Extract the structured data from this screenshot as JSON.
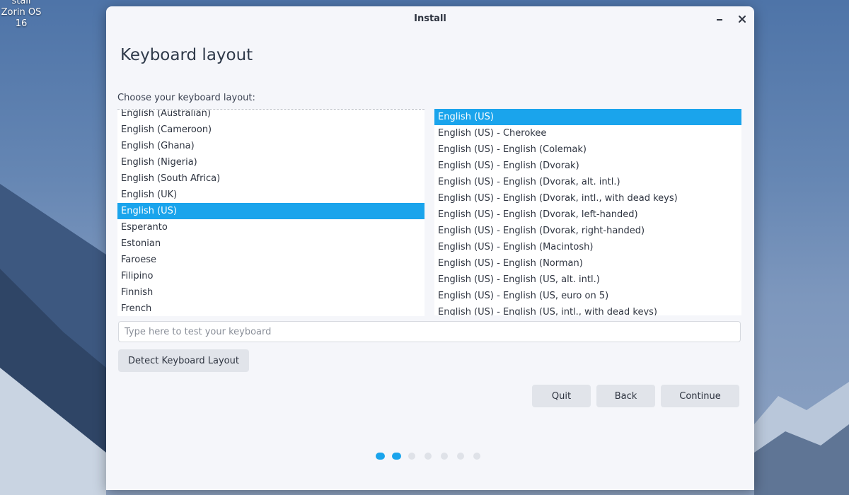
{
  "desktop": {
    "icon_label_line1": "stall Zorin OS",
    "icon_label_line2": "16"
  },
  "window": {
    "title": "Install",
    "minimize_icon": "minimize-icon",
    "close_icon": "close-icon"
  },
  "page": {
    "heading": "Keyboard layout",
    "prompt": "Choose your keyboard layout:"
  },
  "layouts": {
    "items": [
      {
        "label": "English (Australian)",
        "selected": false
      },
      {
        "label": "English (Cameroon)",
        "selected": false
      },
      {
        "label": "English (Ghana)",
        "selected": false
      },
      {
        "label": "English (Nigeria)",
        "selected": false
      },
      {
        "label": "English (South Africa)",
        "selected": false
      },
      {
        "label": "English (UK)",
        "selected": false
      },
      {
        "label": "English (US)",
        "selected": true
      },
      {
        "label": "Esperanto",
        "selected": false
      },
      {
        "label": "Estonian",
        "selected": false
      },
      {
        "label": "Faroese",
        "selected": false
      },
      {
        "label": "Filipino",
        "selected": false
      },
      {
        "label": "Finnish",
        "selected": false
      },
      {
        "label": "French",
        "selected": false
      }
    ]
  },
  "variants": {
    "items": [
      {
        "label": "English (US)",
        "selected": true
      },
      {
        "label": "English (US) - Cherokee",
        "selected": false
      },
      {
        "label": "English (US) - English (Colemak)",
        "selected": false
      },
      {
        "label": "English (US) - English (Dvorak)",
        "selected": false
      },
      {
        "label": "English (US) - English (Dvorak, alt. intl.)",
        "selected": false
      },
      {
        "label": "English (US) - English (Dvorak, intl., with dead keys)",
        "selected": false
      },
      {
        "label": "English (US) - English (Dvorak, left-handed)",
        "selected": false
      },
      {
        "label": "English (US) - English (Dvorak, right-handed)",
        "selected": false
      },
      {
        "label": "English (US) - English (Macintosh)",
        "selected": false
      },
      {
        "label": "English (US) - English (Norman)",
        "selected": false
      },
      {
        "label": "English (US) - English (US, alt. intl.)",
        "selected": false
      },
      {
        "label": "English (US) - English (US, euro on 5)",
        "selected": false
      },
      {
        "label": "English (US) - English (US, intl., with dead keys)",
        "selected": false
      }
    ]
  },
  "test_field": {
    "value": "",
    "placeholder": "Type here to test your keyboard"
  },
  "buttons": {
    "detect": "Detect Keyboard Layout",
    "quit": "Quit",
    "back": "Back",
    "continue": "Continue"
  },
  "progress": {
    "total_steps": 7,
    "completed_steps": 2
  },
  "colors": {
    "accent": "#1aa4ec",
    "window_bg": "#f5f6fa",
    "button_bg": "#e1e4ea"
  }
}
